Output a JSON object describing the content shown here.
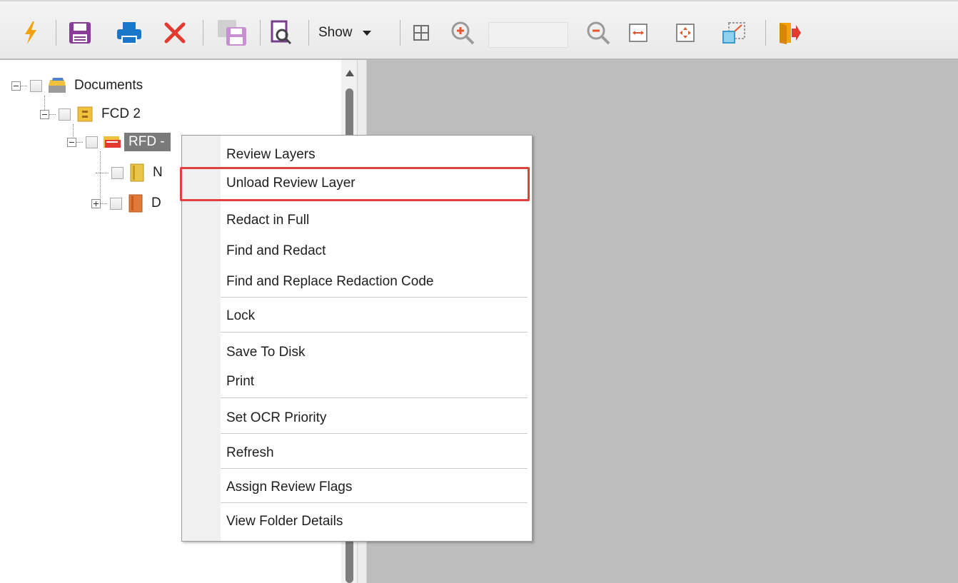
{
  "toolbar": {
    "show_label": "Show",
    "icons": [
      "lightning-icon",
      "save-icon",
      "print-icon",
      "delete-icon",
      "save-copy-icon",
      "find-document-icon",
      "grid-icon",
      "zoom-in-icon",
      "zoom-out-icon",
      "fit-width-icon",
      "fit-page-icon",
      "actual-size-icon",
      "exit-icon"
    ],
    "accent_colors": {
      "lightning": "#f2a20d",
      "save": "#8a3c9a",
      "print": "#1976c8",
      "delete": "#e23a2e",
      "exit": "#f2a20d",
      "zoom": "#e3562f"
    }
  },
  "tree": {
    "root": {
      "label": "Documents"
    },
    "fcd": {
      "label": "FCD 2"
    },
    "rfd": {
      "label": "RFD -"
    },
    "child1": {
      "label": "N"
    },
    "child2": {
      "label": "D"
    }
  },
  "context_menu": {
    "items": [
      "Review Layers",
      "Unload Review Layer",
      "Redact in Full",
      "Find and Redact",
      "Find and Replace Redaction Code",
      "Lock",
      "Save To Disk",
      "Print",
      "Set OCR Priority",
      "Refresh",
      "Assign Review Flags",
      "View Folder Details"
    ],
    "highlighted_item": "Unload Review Layer",
    "highlight_color": "#e0413e"
  }
}
